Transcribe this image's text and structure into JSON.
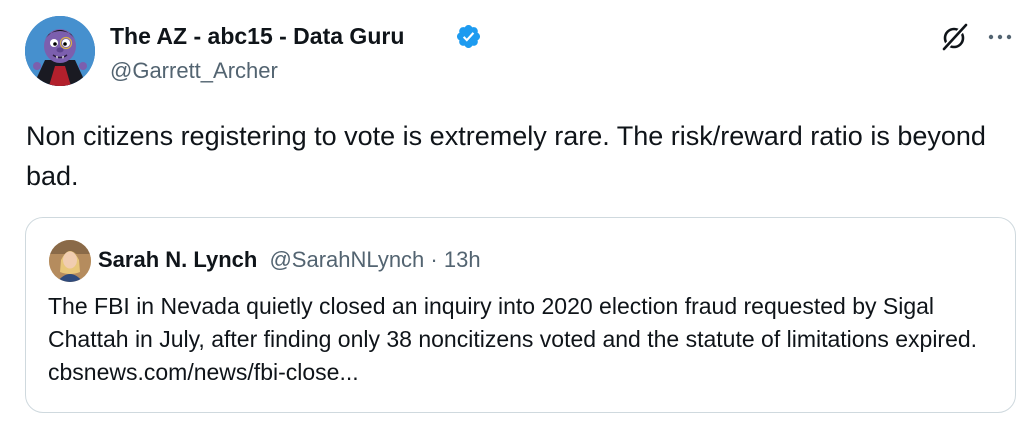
{
  "tweet": {
    "author": {
      "display_name": "The AZ - abc15 - Data Guru",
      "handle": "@Garrett_Archer",
      "verified": true,
      "avatar_icon": "count-von-count-avatar"
    },
    "text": "Non citizens registering to vote is extremely rare. The risk/reward ratio is beyond bad.",
    "actions": {
      "grok_icon": "grok-icon",
      "more_icon": "more-options-icon"
    },
    "accent_color": "#1d9bf0"
  },
  "quoted_tweet": {
    "author": {
      "display_name": "Sarah N. Lynch",
      "handle": "@SarahNLynch",
      "time": "13h",
      "separator": " · ",
      "avatar_icon": "sarah-lynch-avatar"
    },
    "text": "The FBI in Nevada quietly closed an inquiry into 2020 election fraud requested by Sigal Chattah in July, after finding only 38 noncitizens voted and the statute of limitations expired. cbsnews.com/news/fbi-close..."
  }
}
